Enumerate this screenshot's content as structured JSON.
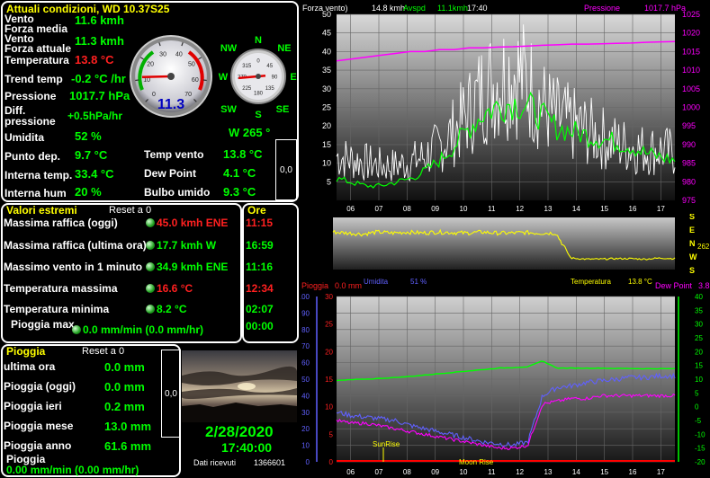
{
  "current": {
    "title": "Attuali condizioni, WD 10.37S25",
    "vento_label": "Vento",
    "forza_media_label": "Forza media",
    "vento_value": "11.6 kmh",
    "vento2_label": "Vento",
    "forza_attuale_label": "Forza attuale",
    "vento2_value": "11.3 kmh",
    "temperatura_label": "Temperatura",
    "temperatura_value": "13.8 °C",
    "trend_label": "Trend temp",
    "trend_value": "-0.2 °C /hr",
    "pressione_label": "Pressione",
    "pressione_value": "1017.7 hPa",
    "diff_label": "Diff.",
    "diff2_label": "pressione",
    "diff_value": "+0.5hPa/hr",
    "umidita_label": "Umidita",
    "umidita_value": "52 %",
    "dir_value": "W  265 °",
    "punto_label": "Punto dep.",
    "punto_value": "9.7 °C",
    "tempvento_label": "Temp vento",
    "tempvento_value": "13.8 °C",
    "interna_label": "Interna temp.",
    "interna_value": "33.4 °C",
    "dew_label": "Dew Point",
    "dew_value": "4.1 °C",
    "hum_label": "Interna hum",
    "hum_value": "20 %",
    "bulbo_label": "Bulbo umido",
    "bulbo_value": "9.3 °C",
    "box_value": "0,0"
  },
  "gauge": {
    "readout": "11.3",
    "ticks": [
      "0",
      "10",
      "20",
      "30",
      "40",
      "50",
      "60",
      "70"
    ],
    "needle_value": 11.3,
    "needle_max": 70
  },
  "compass": {
    "N": "N",
    "NE": "NE",
    "E": "E",
    "SE": "SE",
    "S": "S",
    "SW": "SW",
    "W": "W",
    "NW": "NW",
    "ticks": [
      "0",
      "45",
      "90",
      "135",
      "180",
      "225",
      "270",
      "315"
    ],
    "direction_deg": 265
  },
  "extremes": {
    "title": "Valori estremi",
    "reset": "Reset a 0",
    "ore_title": "Ore",
    "rows": [
      {
        "label": "Massima raffica (oggi)",
        "value": "45.0 kmh ENE",
        "time": "11:15"
      },
      {
        "label": "Massima raffica (ultima ora)",
        "value": "17.7 kmh  W",
        "time": "16:59"
      },
      {
        "label": "Massimo vento in 1 minuto",
        "value": "34.9 kmh ENE",
        "time": "11:16"
      },
      {
        "label": "Temperatura massima",
        "value": "16.6 °C",
        "time": "12:34"
      },
      {
        "label": "Temperatura minima",
        "value": "8.2 °C",
        "time": "02:07"
      },
      {
        "label": "Pioggia max",
        "value": "0.0 mm/min (0.0 mm/hr)",
        "time": "00:00"
      }
    ]
  },
  "rain": {
    "title": "Pioggia",
    "reset": "Reset a 0",
    "rows": [
      {
        "label": "ultima ora",
        "value": "0.0 mm"
      },
      {
        "label": "Pioggia (oggi)",
        "value": "0.0 mm"
      },
      {
        "label": "Pioggia ieri",
        "value": "0.2 mm"
      },
      {
        "label": "Pioggia mese",
        "value": "13.0 mm"
      },
      {
        "label": "Pioggia anno",
        "value": "61.6 mm"
      }
    ],
    "rate_label": "Pioggia",
    "rate_value": "0.00 mm/min (0.00 mm/hr)",
    "box_value": "0,0"
  },
  "status": {
    "date": "2/28/2020",
    "time": "17:40:00",
    "dati_label": "Dati ricevuti",
    "dati_value": "1366601"
  },
  "chart_top": {
    "label_left": "Forza vento)",
    "readout_white": "14.8 kmh",
    "avspd_label": "Avspd",
    "readout_green": "11.1kmh",
    "time": "17:40",
    "pressione_label": "Pressione",
    "pressione_value": "1017.7 hPa"
  },
  "chart_mid": {
    "umidita_label": "Umidita",
    "umidita_value": "51 %",
    "temp_label": "Temperatura",
    "temp_value": "13.8 °C",
    "compass": [
      "S",
      "E",
      "N",
      "W",
      "S"
    ],
    "side_value": "262"
  },
  "chart_bottom": {
    "pioggia_label": "Pioggia",
    "pioggia_value": "0.0 mm",
    "dewpoint_label": "Dew Point",
    "dewpoint_value": "3.8",
    "sunrise_label": "SunRise",
    "moonrise_label": "Moon Rise"
  },
  "colors": {
    "gust": "#ffffff",
    "avspd": "#00ff00",
    "pressure": "#ff00ff",
    "temperature": "#ffff00",
    "humidity": "#6060ff",
    "dewpoint": "#ff00ff",
    "temp_bottom": "#00ff00"
  },
  "chart_data": [
    {
      "type": "line",
      "title": "",
      "x": [
        "06",
        "07",
        "08",
        "09",
        "10",
        "11",
        "12",
        "13",
        "14",
        "15",
        "16",
        "17"
      ],
      "ylim": [
        0,
        50
      ],
      "y2lim": [
        975,
        1025
      ],
      "y_ticks": [
        "5",
        "10",
        "15",
        "20",
        "25",
        "30",
        "35",
        "40",
        "45",
        "50"
      ],
      "y2_ticks": [
        "975",
        "980",
        "985",
        "990",
        "995",
        "1000",
        "1005",
        "1010",
        "1015",
        "1020",
        "1025"
      ],
      "series": [
        {
          "name": "Forza vento",
          "axis": "left",
          "color": "#ffffff",
          "values": [
            14,
            13,
            12,
            11,
            11,
            12,
            14,
            17,
            22,
            28,
            35,
            38,
            41,
            37,
            30,
            26,
            24,
            22,
            20,
            18,
            17,
            16,
            16,
            15
          ]
        },
        {
          "name": "Avspd",
          "axis": "left",
          "color": "#00ff00",
          "values": [
            6,
            5,
            4,
            4,
            5,
            6,
            8,
            11,
            15,
            20,
            24,
            26,
            27,
            26,
            23,
            20,
            19,
            18,
            17,
            16,
            15,
            13,
            12,
            11
          ]
        },
        {
          "name": "Pressione",
          "axis": "right",
          "color": "#ff00ff",
          "values": [
            1012.5,
            1013,
            1013.5,
            1014,
            1014.5,
            1015,
            1015,
            1015.5,
            1015.5,
            1016,
            1016,
            1016.2,
            1016.3,
            1016.5,
            1016.7,
            1016.8,
            1017,
            1017,
            1017.1,
            1017.2,
            1017.3,
            1017.5,
            1017.6,
            1017.7
          ]
        }
      ]
    },
    {
      "type": "line",
      "title": "",
      "x": [
        "06",
        "07",
        "08",
        "09",
        "10",
        "11",
        "12",
        "13",
        "14",
        "15",
        "16",
        "17"
      ],
      "series": [
        {
          "name": "Direzione vento",
          "color": "#ffff00",
          "values": [
            72,
            70,
            68,
            72,
            70,
            72,
            70,
            72,
            71,
            70,
            72,
            70,
            70,
            71,
            70,
            70,
            22,
            20,
            20,
            21,
            21,
            20,
            22,
            21
          ]
        }
      ]
    },
    {
      "type": "line",
      "title": "",
      "x": [
        "06",
        "07",
        "08",
        "09",
        "10",
        "11",
        "12",
        "13",
        "14",
        "15",
        "16",
        "17"
      ],
      "ylim": [
        0,
        100
      ],
      "y2lim": [
        -20,
        40
      ],
      "y_ticks": [
        "0",
        "10",
        "20",
        "30",
        "40",
        "50",
        "60",
        "70",
        "80",
        "90",
        "100"
      ],
      "y_ticks_rain": [
        "0",
        "5",
        "10",
        "15",
        "20",
        "25",
        "30"
      ],
      "y2_ticks": [
        "-20",
        "-15",
        "-10",
        "-5",
        "0",
        "5",
        "10",
        "15",
        "20",
        "25",
        "30",
        "35",
        "40"
      ],
      "series": [
        {
          "name": "Umidita",
          "axis": "left",
          "color": "#6060ff",
          "values": [
            30,
            28,
            27,
            26,
            25,
            22,
            20,
            18,
            16,
            14,
            12,
            11,
            10,
            12,
            40,
            45,
            46,
            48,
            49,
            50,
            51,
            51,
            52,
            52
          ]
        },
        {
          "name": "Dew Point",
          "axis": "right",
          "color": "#ff00ff",
          "values": [
            -5,
            -6,
            -6,
            -7,
            -8,
            -9,
            -10,
            -11,
            -12,
            -13,
            -14,
            -15,
            -15,
            -14,
            1,
            2,
            3,
            3,
            4,
            4,
            4,
            4,
            4,
            4
          ]
        },
        {
          "name": "Temperatura",
          "axis": "right",
          "color": "#00ff00",
          "values": [
            9.5,
            9.8,
            10,
            10.3,
            10.6,
            11,
            11.5,
            12,
            12.5,
            13,
            13.5,
            14,
            14.2,
            14.5,
            16.6,
            14,
            14,
            14,
            14,
            13.9,
            13.9,
            13.8,
            13.8,
            13.8
          ]
        },
        {
          "name": "Pioggia",
          "axis": "rain",
          "color": "#ff0000",
          "values": [
            0,
            0,
            0,
            0,
            0,
            0,
            0,
            0,
            0,
            0,
            0,
            0,
            0,
            0,
            0,
            0,
            0,
            0,
            0,
            0,
            0,
            0,
            0,
            0
          ]
        }
      ]
    }
  ]
}
